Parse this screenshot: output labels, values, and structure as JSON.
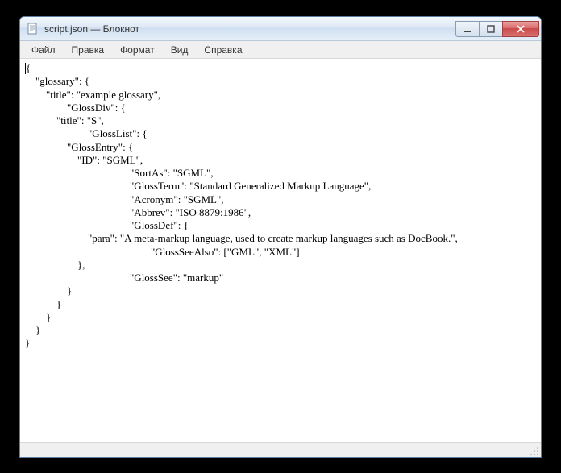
{
  "window": {
    "title": "script.json — Блокнот"
  },
  "menu": {
    "file": "Файл",
    "edit": "Правка",
    "format": "Формат",
    "view": "Вид",
    "help": "Справка"
  },
  "editor": {
    "content": "{\n    \"glossary\": {\n        \"title\": \"example glossary\",\n\t\t\"GlossDiv\": {\n            \"title\": \"S\",\n\t\t\t\"GlossList\": {\n                \"GlossEntry\": {\n                    \"ID\": \"SGML\",\n\t\t\t\t\t\"SortAs\": \"SGML\",\n\t\t\t\t\t\"GlossTerm\": \"Standard Generalized Markup Language\",\n\t\t\t\t\t\"Acronym\": \"SGML\",\n\t\t\t\t\t\"Abbrev\": \"ISO 8879:1986\",\n\t\t\t\t\t\"GlossDef\": {\n                        \"para\": \"A meta-markup language, used to create markup languages such as DocBook.\",\n\t\t\t\t\t\t\"GlossSeeAlso\": [\"GML\", \"XML\"]\n                    },\n\t\t\t\t\t\"GlossSee\": \"markup\"\n                }\n            }\n        }\n    }\n}"
  }
}
